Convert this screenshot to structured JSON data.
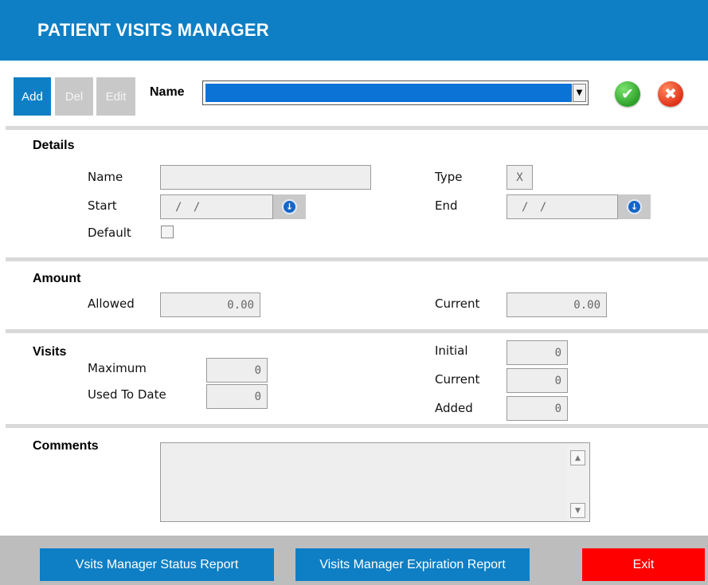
{
  "header": {
    "title": "PATIENT VISITS MANAGER"
  },
  "toolbar": {
    "add_label": "Add",
    "del_label": "Del",
    "edit_label": "Edit",
    "name_label": "Name",
    "name_select_value": "",
    "ok_icon": "check-icon",
    "cancel_icon": "x-icon"
  },
  "details": {
    "title": "Details",
    "name_label": "Name",
    "name_value": "",
    "type_label": "Type",
    "type_value": "X",
    "start_label": "Start",
    "start_value": "/ /",
    "end_label": "End",
    "end_value": "/ /",
    "default_label": "Default"
  },
  "amount": {
    "title": "Amount",
    "allowed_label": "Allowed",
    "allowed_value": "0.00",
    "current_label": "Current",
    "current_value": "0.00"
  },
  "visits": {
    "title": "Visits",
    "maximum_label": "Maximum",
    "maximum_value": "0",
    "used_label": "Used To Date",
    "used_value": "0",
    "initial_label": "Initial",
    "initial_value": "0",
    "current_label": "Current",
    "current_value": "0",
    "added_label": "Added",
    "added_value": "0"
  },
  "comments": {
    "title": "Comments",
    "value": ""
  },
  "footer": {
    "status_report_label": "Vsits Manager Status Report",
    "expiration_report_label": "Visits Manager Expiration Report",
    "exit_label": "Exit"
  },
  "colors": {
    "header_blue": "#0e7fc4",
    "exit_red": "#ff0000",
    "ok_green": "#2da02a",
    "cancel_red": "#e0321a"
  }
}
